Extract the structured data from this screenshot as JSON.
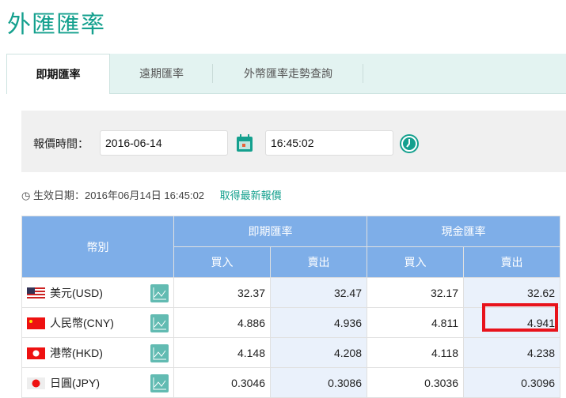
{
  "title": "外匯匯率",
  "tabs": [
    {
      "label": "即期匯率"
    },
    {
      "label": "遠期匯率"
    },
    {
      "label": "外幣匯率走勢查詢"
    }
  ],
  "search": {
    "label": "報價時間：",
    "date": "2016-06-14",
    "time": "16:45:02"
  },
  "effective": {
    "text": "生效日期：2016年06月14日 16:45:02",
    "refresh_link": "取得最新報價"
  },
  "table": {
    "headers": {
      "currency": "幣別",
      "spot": "即期匯率",
      "cash": "現金匯率",
      "buy": "買入",
      "sell": "賣出"
    },
    "rows": [
      {
        "name": "美元(USD)",
        "spot_buy": "32.37",
        "spot_sell": "32.47",
        "cash_buy": "32.17",
        "cash_sell": "32.62"
      },
      {
        "name": "人民幣(CNY)",
        "spot_buy": "4.886",
        "spot_sell": "4.936",
        "cash_buy": "4.811",
        "cash_sell": "4.941"
      },
      {
        "name": "港幣(HKD)",
        "spot_buy": "4.148",
        "spot_sell": "4.208",
        "cash_buy": "4.118",
        "cash_sell": "4.238"
      },
      {
        "name": "日圓(JPY)",
        "spot_buy": "0.3046",
        "spot_sell": "0.3086",
        "cash_buy": "0.3036",
        "cash_sell": "0.3096"
      }
    ]
  },
  "colors": {
    "accent": "#14a08e",
    "header": "#7eaee8",
    "highlight": "#e8131b"
  }
}
